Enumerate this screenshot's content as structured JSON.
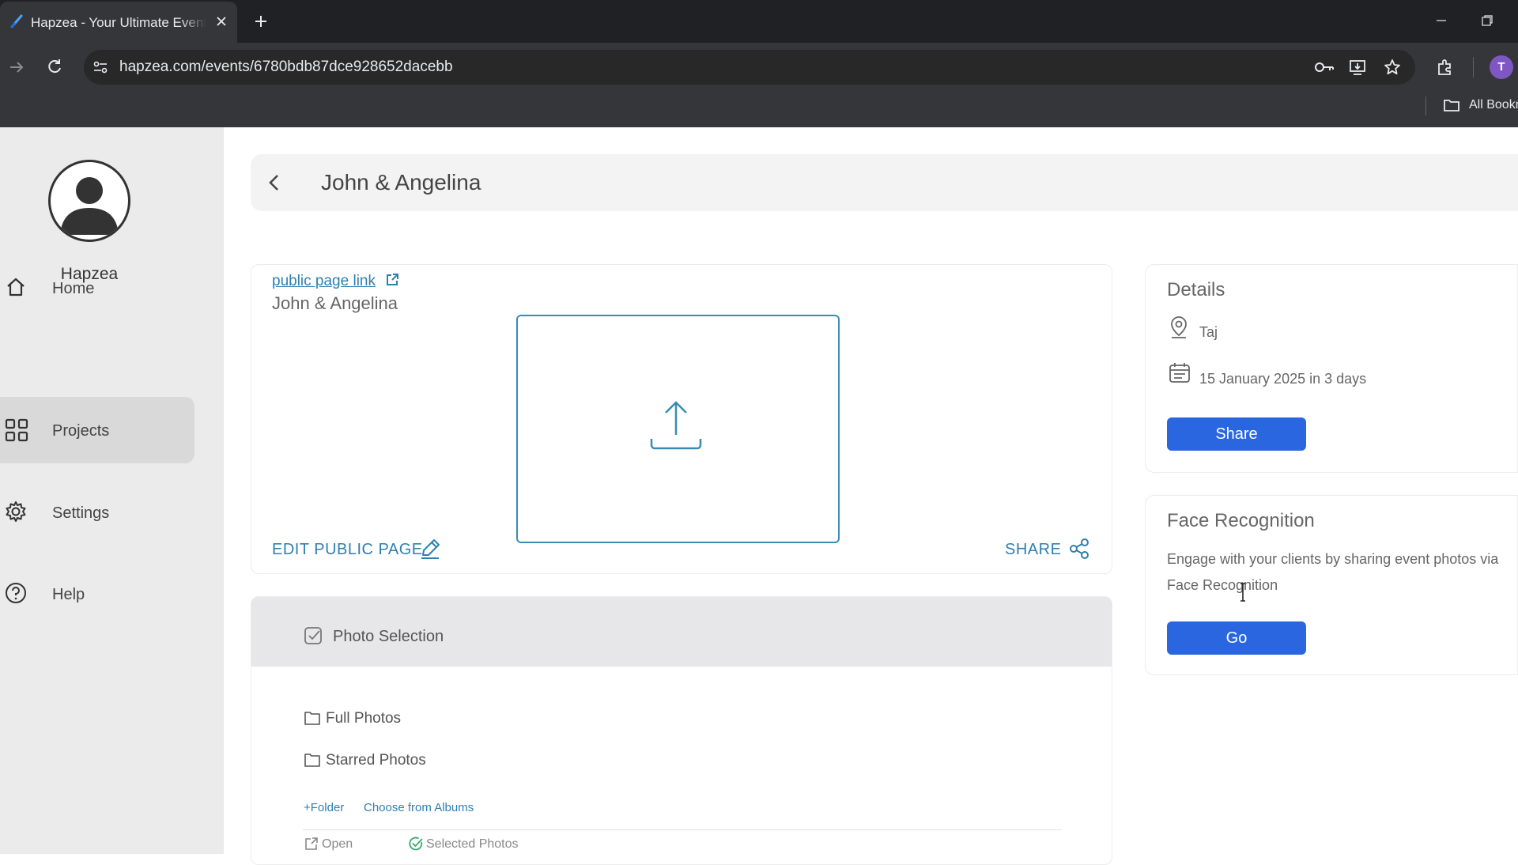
{
  "browser": {
    "tab_title": "Hapzea - Your Ultimate Event Planner",
    "url": "hapzea.com/events/6780bdb87dce928652dacebb",
    "profile_initial": "T",
    "bookmarks_label": "All Bookmarks"
  },
  "sidebar": {
    "brand": "Hapzea",
    "items": [
      {
        "label": "Home",
        "icon": "home-icon",
        "active": false
      },
      {
        "label": "Projects",
        "icon": "grid-icon",
        "active": true
      },
      {
        "label": "Settings",
        "icon": "gear-icon",
        "active": false
      },
      {
        "label": "Help",
        "icon": "help-icon",
        "active": false
      }
    ]
  },
  "header": {
    "title": "John & Angelina"
  },
  "event_card": {
    "public_link_label": "public page link",
    "event_name": "John & Angelina",
    "edit_label": "EDIT PUBLIC PAGE",
    "share_label": "SHARE"
  },
  "photo_selection": {
    "title": "Photo Selection",
    "folders": [
      "Full Photos",
      "Starred Photos"
    ],
    "add_folder_label": "+Folder",
    "choose_albums_label": "Choose from Albums",
    "open_label": "Open",
    "selected_label": "Selected Photos"
  },
  "details": {
    "title": "Details",
    "location": "Taj",
    "date": "15 January 2025 in 3 days",
    "share_button": "Share"
  },
  "face_recognition": {
    "title": "Face Recognition",
    "description": "Engage with your clients by sharing event photos via Face Recognition",
    "go_button": "Go"
  },
  "colors": {
    "accent_blue": "#2b66e1",
    "link_blue": "#2f7fb0",
    "sidebar_bg": "#ebebeb",
    "chrome_dark": "#202124"
  }
}
